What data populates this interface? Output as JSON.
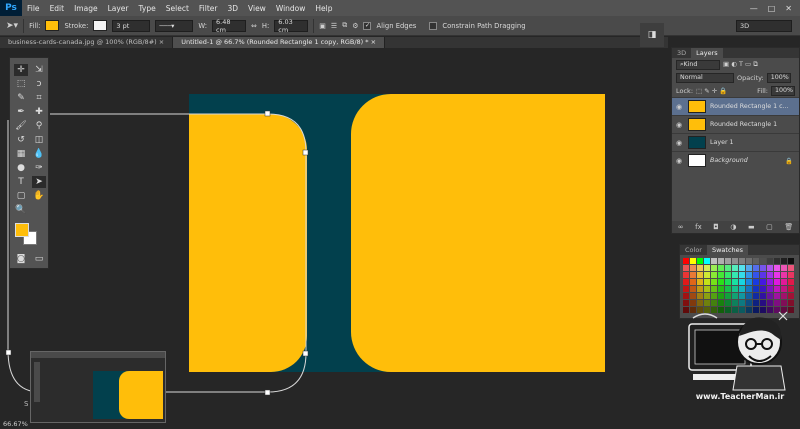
{
  "app": {
    "logo": "Ps"
  },
  "menu": {
    "items": [
      "File",
      "Edit",
      "Image",
      "Layer",
      "Type",
      "Select",
      "Filter",
      "3D",
      "View",
      "Window",
      "Help"
    ]
  },
  "window_controls": {
    "minimize": "—",
    "maximize": "□",
    "close": "✕"
  },
  "options": {
    "fill_label": "Fill:",
    "stroke_label": "Stroke:",
    "stroke_width": "3 pt",
    "w_label": "W:",
    "w_value": "6.48 cm",
    "h_label": "H:",
    "h_value": "6.03 cm",
    "align_edges": "Align Edges",
    "constrain": "Constrain Path Dragging",
    "workspace": "3D",
    "fill_color": "#ffbe0a"
  },
  "tabs": [
    {
      "label": "business-cards-canada.jpg @ 100% (RGB/8#) ×"
    },
    {
      "label": "Untitled-1 @ 66.7% (Rounded Rectangle 1 copy, RGB/8) * ×"
    }
  ],
  "canvas": {
    "background_color": "#02404d",
    "shape_color": "#ffbe0a"
  },
  "status": {
    "zoom": "66.67%"
  },
  "layers_panel": {
    "tab_3d": "3D",
    "tab_layers": "Layers",
    "kind": "Kind",
    "blend_mode": "Normal",
    "opacity_label": "Opacity:",
    "opacity_value": "100%",
    "lock_label": "Lock:",
    "fill_label": "Fill:",
    "fill_value": "100%",
    "layers": [
      {
        "name": "Rounded Rectangle 1 c...",
        "selected": true
      },
      {
        "name": "Rounded Rectangle 1",
        "selected": false
      },
      {
        "name": "Layer 1",
        "selected": false
      },
      {
        "name": "Background",
        "selected": false
      }
    ]
  },
  "swatches_panel": {
    "tab_color": "Color",
    "tab_swatches": "Swatches"
  },
  "watermark": {
    "text": "www.TeacherMan.ir"
  },
  "icons": [
    "move-tool-icon",
    "marquee-tool-icon",
    "lasso-tool-icon",
    "crop-tool-icon",
    "brush-tool-icon",
    "eye-icon",
    "lock-icon",
    "trash-icon"
  ]
}
